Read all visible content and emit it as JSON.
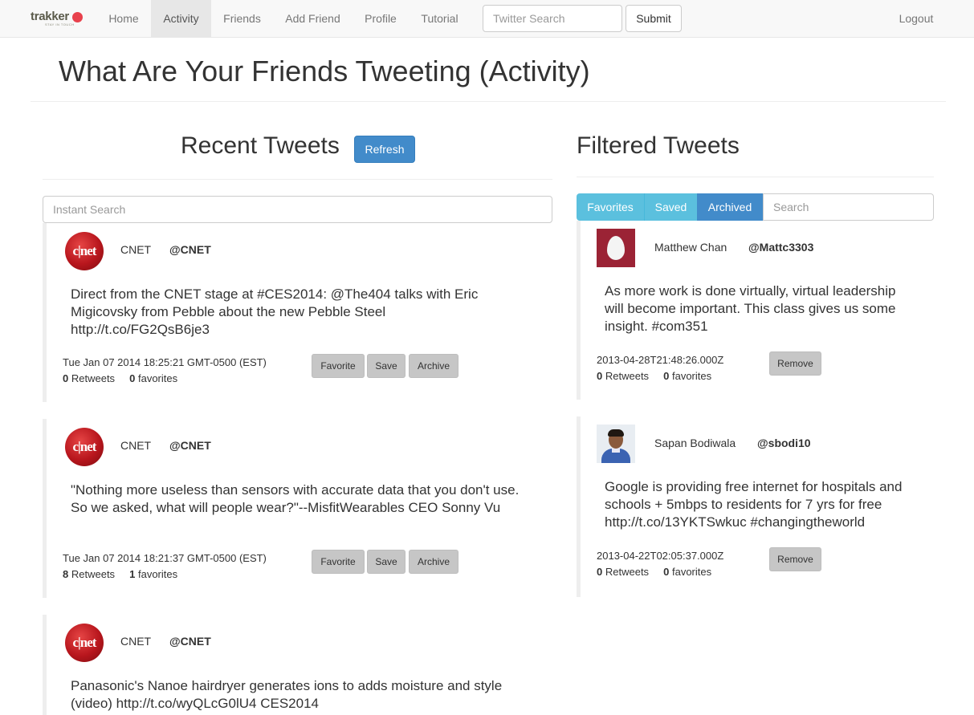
{
  "navbar": {
    "brand": "trakker",
    "brand_sub": "STAY IN TOUCH",
    "items": [
      {
        "label": "Home"
      },
      {
        "label": "Activity"
      },
      {
        "label": "Friends"
      },
      {
        "label": "Add Friend"
      },
      {
        "label": "Profile"
      },
      {
        "label": "Tutorial"
      }
    ],
    "active": "Activity",
    "search_placeholder": "Twitter Search",
    "submit_label": "Submit",
    "logout_label": "Logout"
  },
  "page": {
    "title": "What Are Your Friends Tweeting (Activity)"
  },
  "recent": {
    "title": "Recent Tweets",
    "refresh_label": "Refresh",
    "search_placeholder": "Instant Search",
    "buttons": {
      "favorite": "Favorite",
      "save": "Save",
      "archive": "Archive"
    },
    "tweets": [
      {
        "name": "CNET",
        "handle": "@CNET",
        "avatar": "cnet-logo",
        "text": "Direct from the CNET stage at #CES2014: @The404 talks with Eric Migicovsky from Pebble about the new Pebble Steel http://t.co/FG2QsB6je3",
        "date": "Tue Jan 07 2014 18:25:21 GMT-0500 (EST)",
        "retweets": "0",
        "retweets_label": "Retweets",
        "favorites": "0",
        "favorites_label": "favorites"
      },
      {
        "name": "CNET",
        "handle": "@CNET",
        "avatar": "cnet-logo",
        "text": "\"Nothing more useless than sensors with accurate data that you don't use. So we asked, what will people wear?\"--MisfitWearables CEO Sonny Vu",
        "date": "Tue Jan 07 2014 18:21:37 GMT-0500 (EST)",
        "retweets": "8",
        "retweets_label": "Retweets",
        "favorites": "1",
        "favorites_label": "favorites"
      },
      {
        "name": "CNET",
        "handle": "@CNET",
        "avatar": "cnet-logo",
        "text": "Panasonic's Nanoe hairdryer generates ions to adds moisture and style (video) http://t.co/wyQLcG0lU4 CES2014"
      }
    ]
  },
  "filtered": {
    "title": "Filtered Tweets",
    "tabs": [
      {
        "label": "Favorites"
      },
      {
        "label": "Saved"
      },
      {
        "label": "Archived"
      }
    ],
    "active_tab": "Archived",
    "search_placeholder": "Search",
    "remove_label": "Remove",
    "tweets": [
      {
        "name": "Matthew Chan",
        "handle": "@Mattc3303",
        "avatar": "egg-avatar",
        "text": "As more work is done virtually, virtual leadership will become important. This class gives us some insight. #com351",
        "date": "2013-04-28T21:48:26.000Z",
        "retweets": "0",
        "retweets_label": "Retweets",
        "favorites": "0",
        "favorites_label": "favorites"
      },
      {
        "name": "Sapan Bodiwala",
        "handle": "@sbodi10",
        "avatar": "person-photo",
        "text": "Google is providing free internet for hospitals and schools + 5mbps to residents for 7 yrs for free http://t.co/13YKTSwkuc #changingtheworld",
        "date": "2013-04-22T02:05:37.000Z",
        "retweets": "0",
        "retweets_label": "Retweets",
        "favorites": "0",
        "favorites_label": "favorites"
      }
    ]
  },
  "colors": {
    "primary": "#428bca",
    "info": "#5bc0de",
    "brand_dot": "#e8414c",
    "button_gray": "#c6c6c6"
  }
}
